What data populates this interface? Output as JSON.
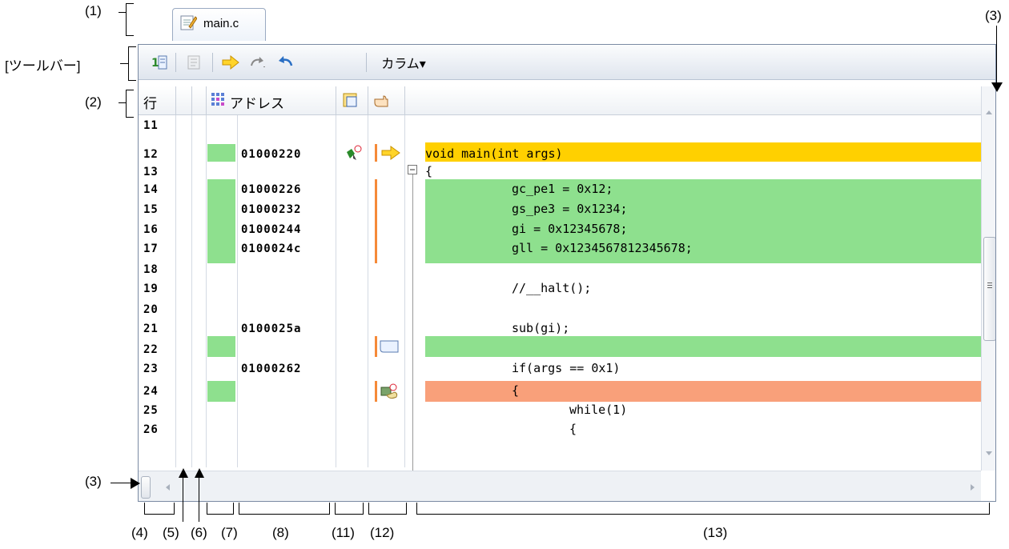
{
  "callouts": {
    "c1": "(1)",
    "c2": "(2)",
    "c3_top": "(3)",
    "c3_left": "(3)",
    "toolbar": "[ツールバー]",
    "c4": "(4)",
    "c5": "(5)",
    "c6": "(6)",
    "c7": "(7)",
    "c8": "(8)",
    "c11": "(11)",
    "c12": "(12)",
    "c13": "(13)"
  },
  "tab": {
    "label": "main.c"
  },
  "toolbar": {
    "column_menu": "カラム▾"
  },
  "header": {
    "line": "行",
    "address": "アドレス"
  },
  "colors": {
    "coverage": "#8ee08e",
    "current_pc": "#ffd000",
    "breakpoint": "#f9a07a",
    "marker": "#f58a38"
  },
  "rows": [
    {
      "num": "11",
      "addr": "",
      "code": ""
    },
    {
      "num": "12",
      "addr": "01000220",
      "code": "void main(int args)"
    },
    {
      "num": "13",
      "addr": "",
      "code": "{"
    },
    {
      "num": "14",
      "addr": "01000226",
      "code": "gc_pe1 = 0x12;"
    },
    {
      "num": "15",
      "addr": "01000232",
      "code": "gs_pe3 = 0x1234;"
    },
    {
      "num": "16",
      "addr": "01000244",
      "code": "gi = 0x12345678;"
    },
    {
      "num": "17",
      "addr": "0100024c",
      "code": "gll = 0x1234567812345678;"
    },
    {
      "num": "18",
      "addr": "",
      "code": ""
    },
    {
      "num": "19",
      "addr": "",
      "code": "//__halt();"
    },
    {
      "num": "20",
      "addr": "",
      "code": ""
    },
    {
      "num": "21",
      "addr": "0100025a",
      "code": "sub(gi);"
    },
    {
      "num": "22",
      "addr": "",
      "code": ""
    },
    {
      "num": "23",
      "addr": "01000262",
      "code": "if(args == 0x1)"
    },
    {
      "num": "24",
      "addr": "",
      "code": "{"
    },
    {
      "num": "25",
      "addr": "",
      "code": "while(1)"
    },
    {
      "num": "26",
      "addr": "",
      "code": "{"
    }
  ]
}
